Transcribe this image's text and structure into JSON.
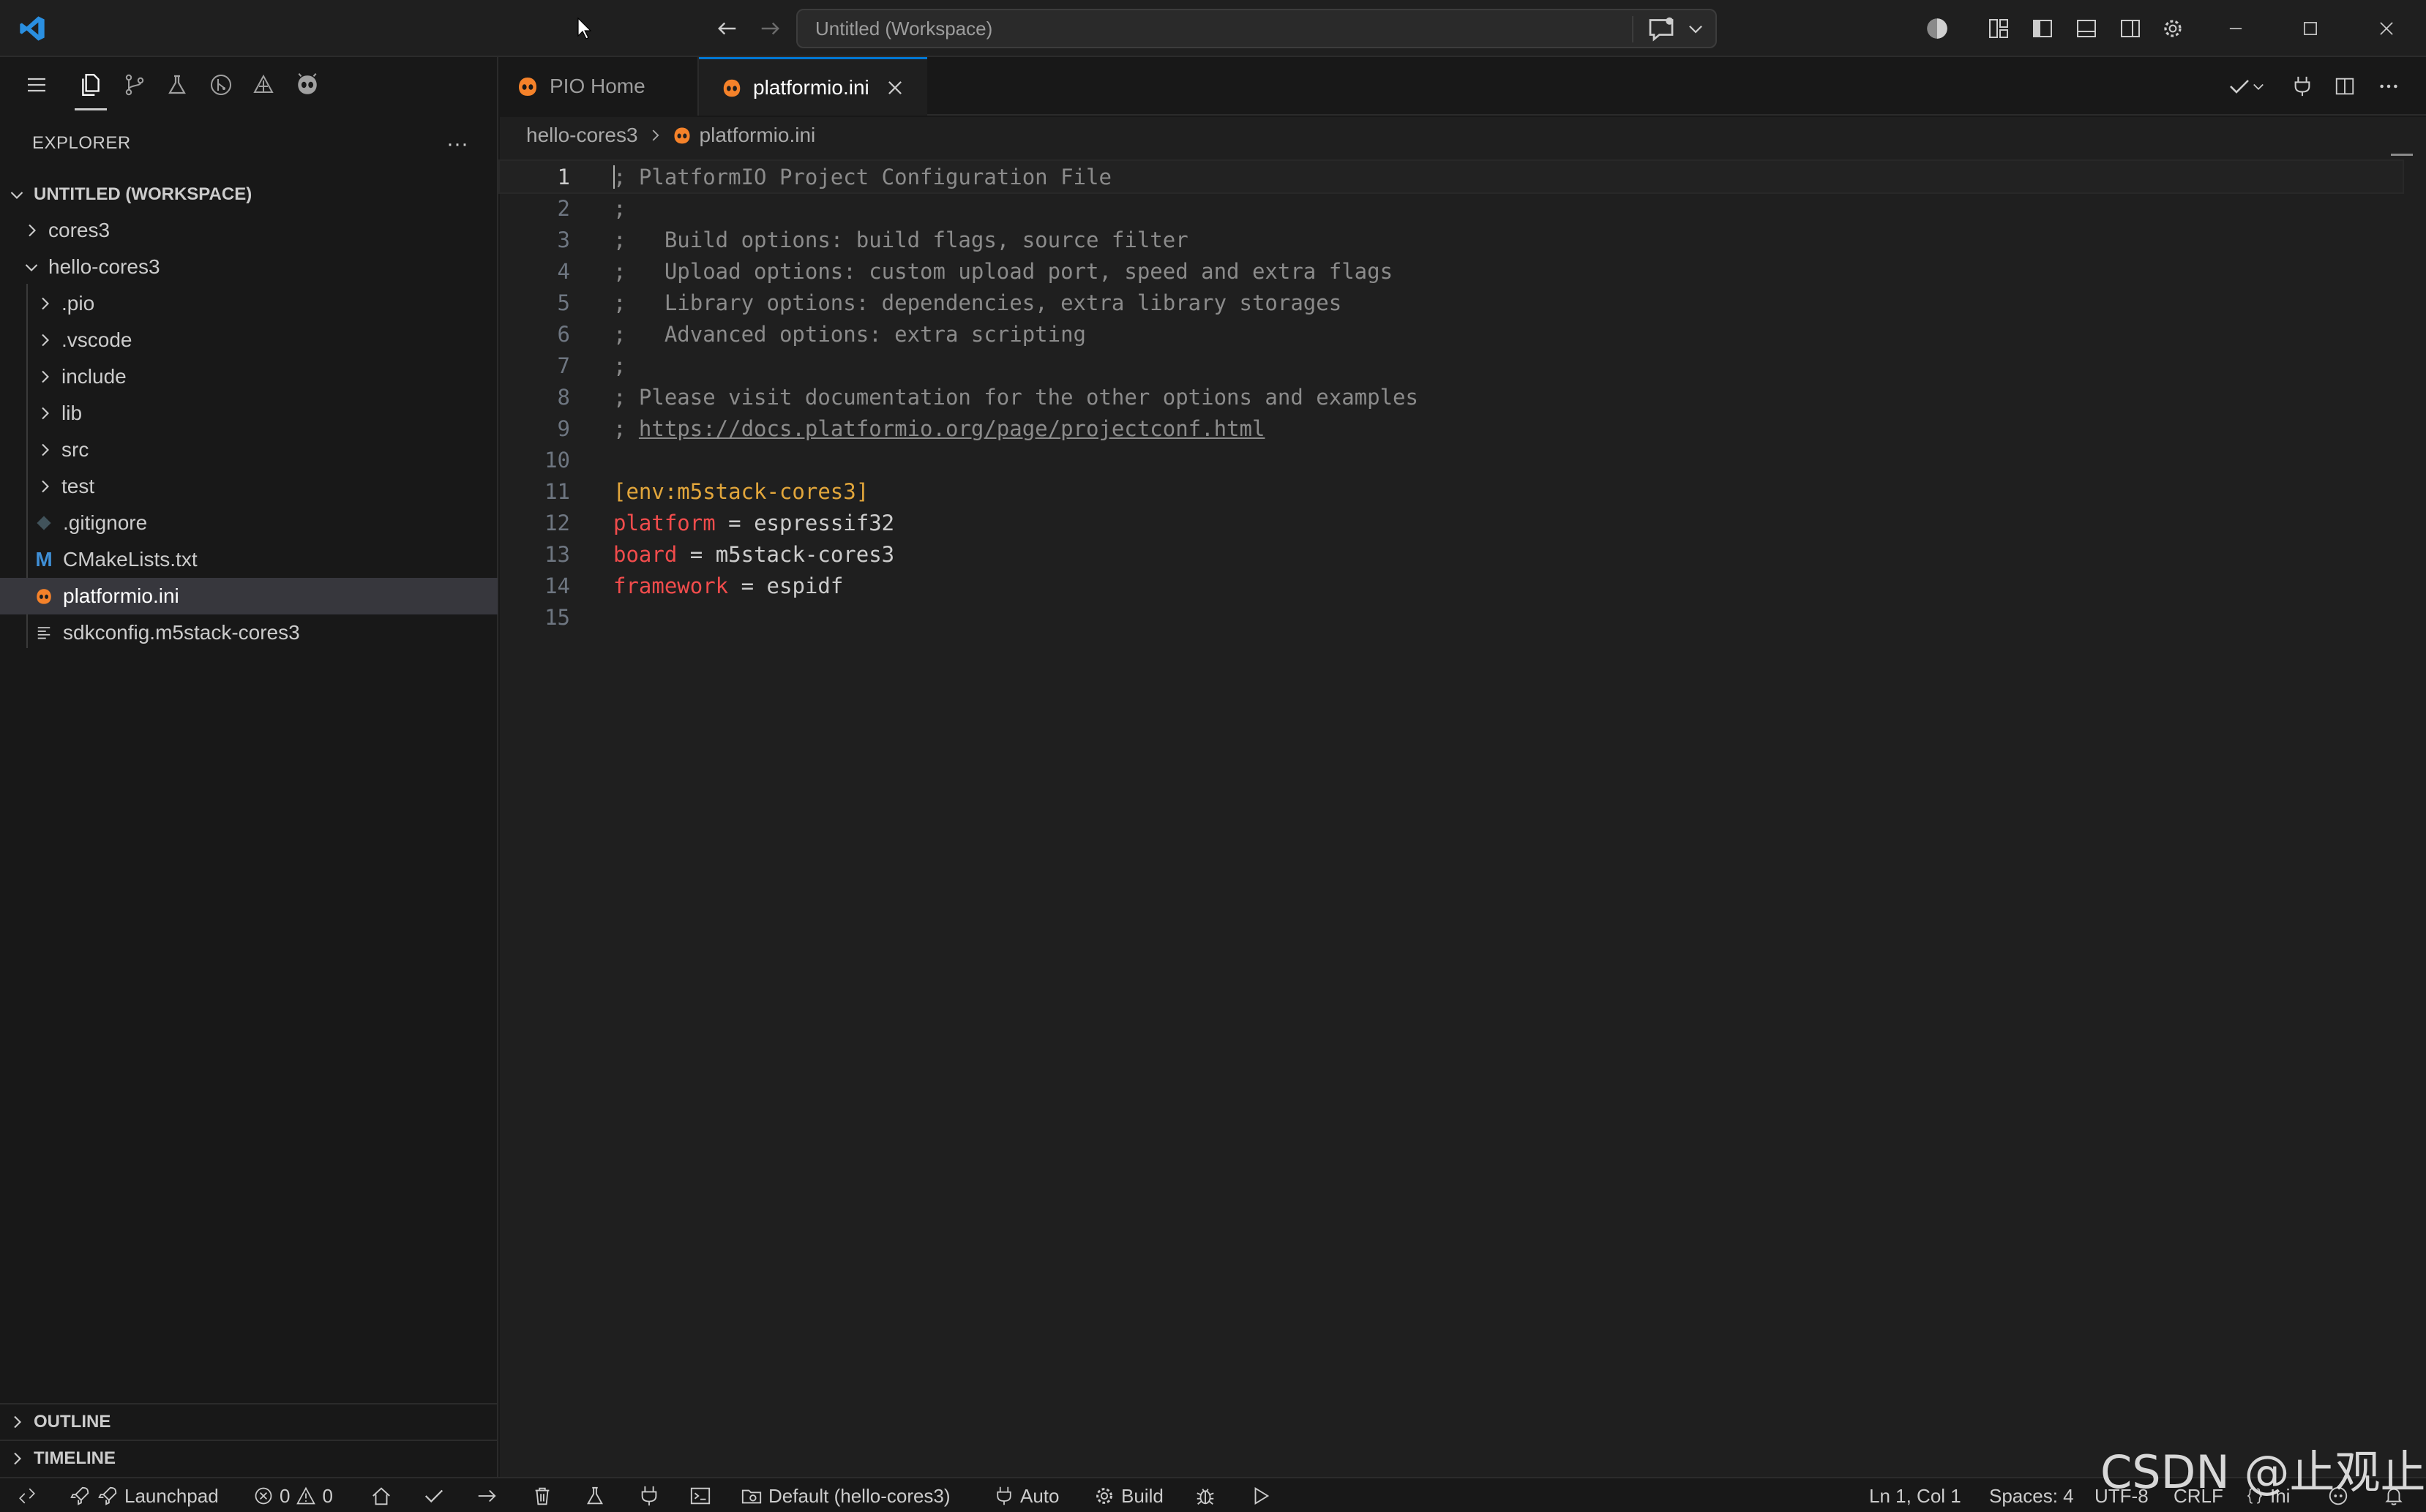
{
  "window": {
    "search_placeholder": "Untitled (Workspace)"
  },
  "sidebar": {
    "title": "EXPLORER",
    "more": "···",
    "workspace_label": "UNTITLED (WORKSPACE)",
    "tree": [
      {
        "label": "cores3",
        "type": "folder",
        "expanded": false,
        "level": 0
      },
      {
        "label": "hello-cores3",
        "type": "folder",
        "expanded": true,
        "level": 0
      },
      {
        "label": ".pio",
        "type": "folder",
        "expanded": false,
        "level": 1
      },
      {
        "label": ".vscode",
        "type": "folder",
        "expanded": false,
        "level": 1
      },
      {
        "label": "include",
        "type": "folder",
        "expanded": false,
        "level": 1
      },
      {
        "label": "lib",
        "type": "folder",
        "expanded": false,
        "level": 1
      },
      {
        "label": "src",
        "type": "folder",
        "expanded": false,
        "level": 1
      },
      {
        "label": "test",
        "type": "folder",
        "expanded": false,
        "level": 1
      },
      {
        "label": ".gitignore",
        "type": "file",
        "icon": "git-diamond-icon",
        "level": 1
      },
      {
        "label": "CMakeLists.txt",
        "type": "file",
        "icon": "cmake-m-icon",
        "level": 1
      },
      {
        "label": "platformio.ini",
        "type": "file",
        "icon": "platformio-icon",
        "level": 1,
        "selected": true
      },
      {
        "label": "sdkconfig.m5stack-cores3",
        "type": "file",
        "icon": "lines-icon",
        "level": 1
      }
    ],
    "cmake_icon_letter": "M",
    "outline_label": "OUTLINE",
    "timeline_label": "TIMELINE"
  },
  "tabs": [
    {
      "label": "PIO Home",
      "active": false
    },
    {
      "label": "platformio.ini",
      "active": true
    }
  ],
  "breadcrumb": {
    "folder": "hello-cores3",
    "file": "platformio.ini"
  },
  "editor": {
    "lines": [
      {
        "n": "1",
        "parts": [
          {
            "t": "; PlatformIO Project Configuration File",
            "c": "comment"
          }
        ]
      },
      {
        "n": "2",
        "parts": [
          {
            "t": ";",
            "c": "comment"
          }
        ]
      },
      {
        "n": "3",
        "parts": [
          {
            "t": ";   Build options: build flags, source filter",
            "c": "comment"
          }
        ]
      },
      {
        "n": "4",
        "parts": [
          {
            "t": ";   Upload options: custom upload port, speed and extra flags",
            "c": "comment"
          }
        ]
      },
      {
        "n": "5",
        "parts": [
          {
            "t": ";   Library options: dependencies, extra library storages",
            "c": "comment"
          }
        ]
      },
      {
        "n": "6",
        "parts": [
          {
            "t": ";   Advanced options: extra scripting",
            "c": "comment"
          }
        ]
      },
      {
        "n": "7",
        "parts": [
          {
            "t": ";",
            "c": "comment"
          }
        ]
      },
      {
        "n": "8",
        "parts": [
          {
            "t": "; Please visit documentation for the other options and examples",
            "c": "comment"
          }
        ]
      },
      {
        "n": "9",
        "parts": [
          {
            "t": "; ",
            "c": "comment"
          },
          {
            "t": "https://docs.platformio.org/page/projectconf.html",
            "c": "link"
          }
        ]
      },
      {
        "n": "10",
        "parts": []
      },
      {
        "n": "11",
        "parts": [
          {
            "t": "[env:m5stack-cores3]",
            "c": "section"
          }
        ]
      },
      {
        "n": "12",
        "parts": [
          {
            "t": "platform",
            "c": "key"
          },
          {
            "t": " = espressif32",
            "c": "val"
          }
        ]
      },
      {
        "n": "13",
        "parts": [
          {
            "t": "board",
            "c": "key"
          },
          {
            "t": " = m5stack-cores3",
            "c": "val"
          }
        ]
      },
      {
        "n": "14",
        "parts": [
          {
            "t": "framework",
            "c": "key"
          },
          {
            "t": " = espidf",
            "c": "val"
          }
        ]
      },
      {
        "n": "15",
        "parts": []
      }
    ]
  },
  "statusbar": {
    "launchpad": "Launchpad",
    "errors": "0",
    "warnings": "0",
    "env": "Default (hello-cores3)",
    "auto": "Auto",
    "build": "Build",
    "position": "Ln 1, Col 1",
    "spaces": "Spaces: 4",
    "encoding": "UTF-8",
    "eol": "CRLF",
    "language": "Ini"
  },
  "watermark": "CSDN @止观止",
  "colors": {
    "accent": "#0078d4",
    "platformio_orange": "#f5822a",
    "cmake_blue": "#3f8fd6"
  }
}
